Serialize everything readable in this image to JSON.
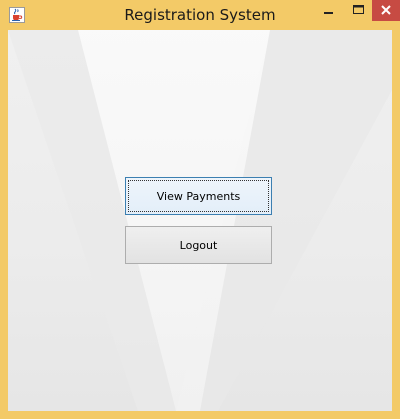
{
  "window": {
    "title": "Registration System",
    "frame_color": "#f3ca67",
    "close_color": "#c74b43",
    "icons": {
      "app": "java-cup-icon",
      "minimize": "minimize-icon",
      "maximize": "maximize-icon",
      "close": "close-icon"
    }
  },
  "main": {
    "view_payments_label": "View Payments",
    "logout_label": "Logout"
  }
}
